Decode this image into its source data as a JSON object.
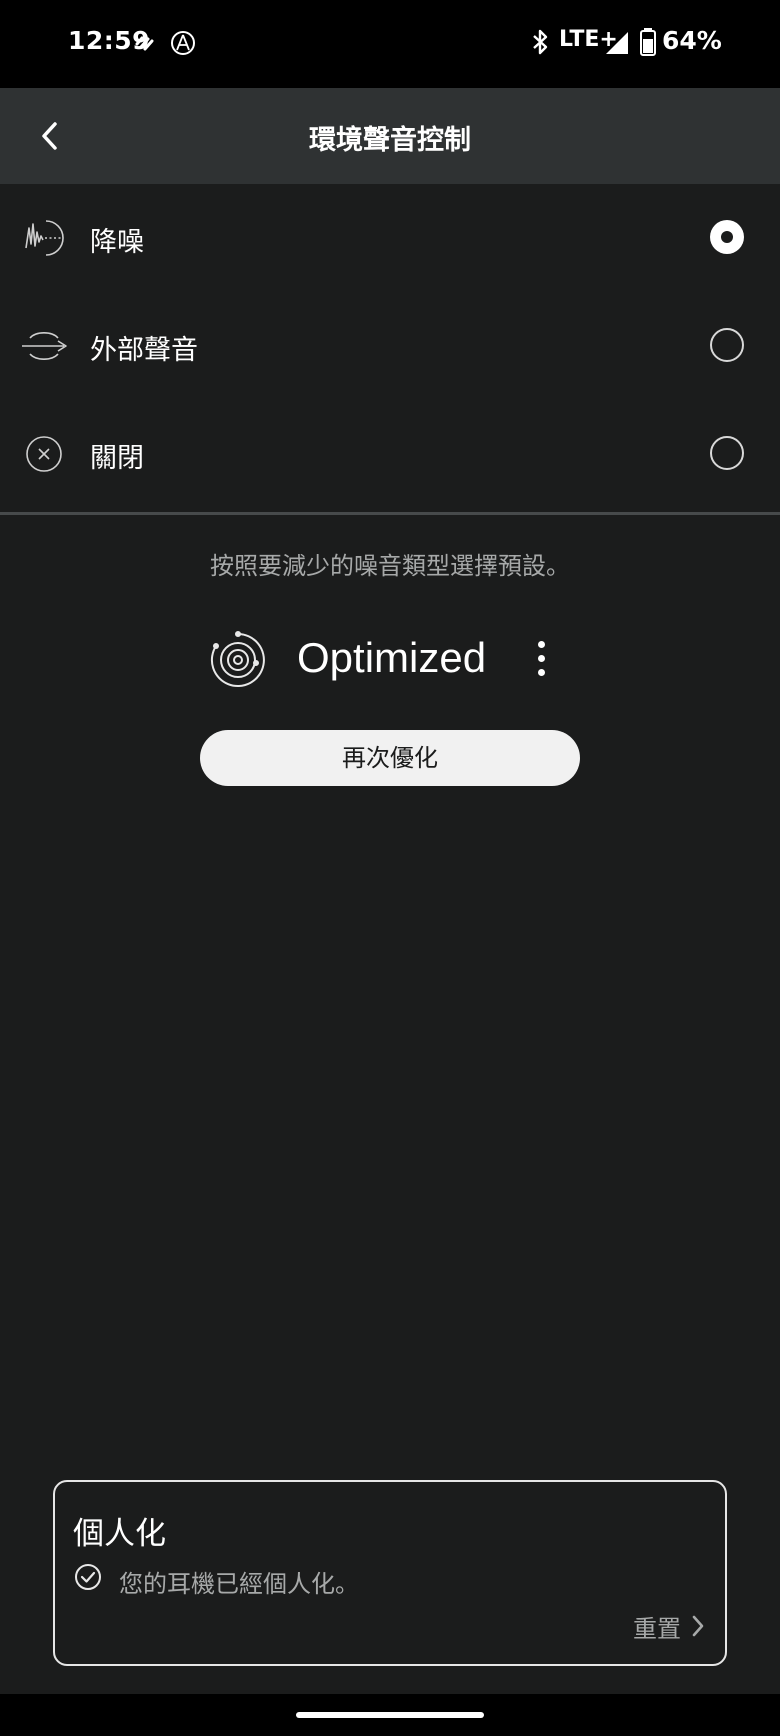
{
  "status_bar": {
    "time": "12:59",
    "network": "LTE+",
    "battery": "64%"
  },
  "header": {
    "title": "環境聲音控制"
  },
  "modes": [
    {
      "label": "降噪",
      "icon": "noise-cancel-icon",
      "selected": true
    },
    {
      "label": "外部聲音",
      "icon": "ambient-sound-icon",
      "selected": false
    },
    {
      "label": "關閉",
      "icon": "off-icon",
      "selected": false
    }
  ],
  "hint": "按照要減少的噪音類型選擇預設。",
  "preset": {
    "name": "Optimized",
    "icon": "optimize-target-icon"
  },
  "reoptimize_label": "再次優化",
  "personalization": {
    "title": "個人化",
    "status": "您的耳機已經個人化。",
    "reset_label": "重置"
  },
  "colors": {
    "background": "#1b1c1c",
    "header": "#2f3233",
    "secondary_text": "#a7a9a9"
  }
}
